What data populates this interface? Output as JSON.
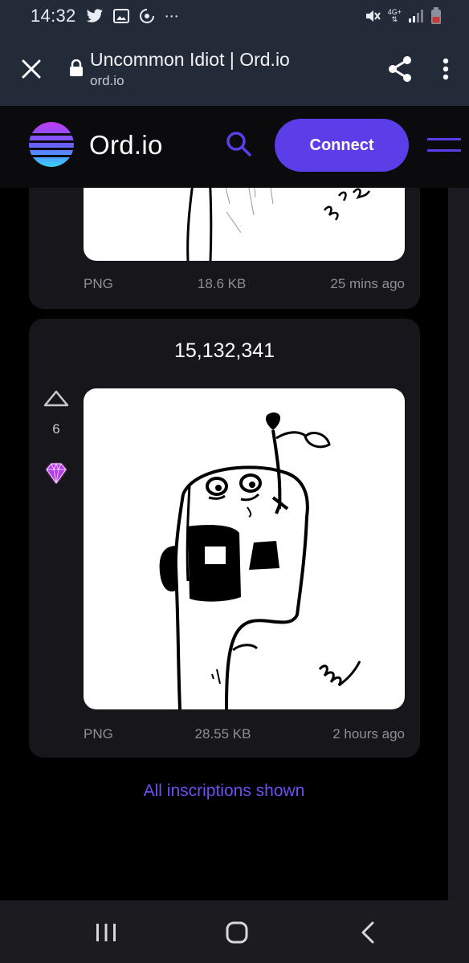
{
  "status_bar": {
    "time": "14:32",
    "network_label": "4G+",
    "icons_left": [
      "twitter-icon",
      "gallery-icon",
      "sync-icon",
      "more-notifications-icon"
    ],
    "icons_right": [
      "mute-icon",
      "network-icon",
      "signal-icon",
      "battery-icon"
    ]
  },
  "browser": {
    "title": "Uncommon Idiot | Ord.io",
    "url": "ord.io"
  },
  "site": {
    "logo_text": "Ord.io",
    "connect_label": "Connect"
  },
  "cards": [
    {
      "number": "",
      "format": "PNG",
      "size": "18.6 KB",
      "age": "25 mins ago"
    },
    {
      "number": "15,132,341",
      "votes": "6",
      "format": "PNG",
      "size": "28.55 KB",
      "age": "2 hours ago"
    }
  ],
  "footer_message": "All inscriptions shown",
  "colors": {
    "accent": "#5b3ee8",
    "link": "#6b4ff0",
    "card_bg": "#17171b",
    "browser_bar": "#232a38"
  }
}
